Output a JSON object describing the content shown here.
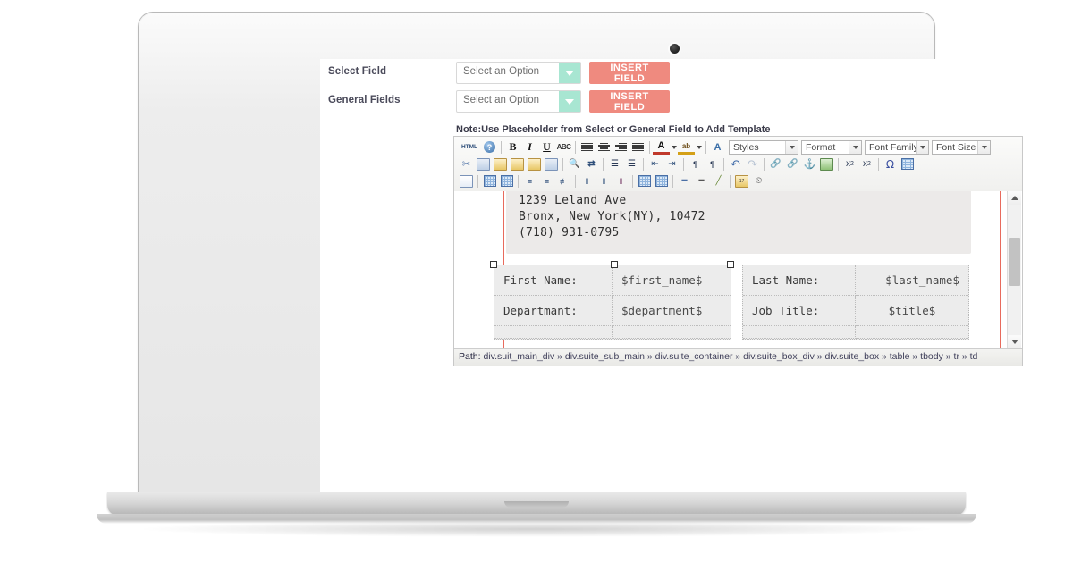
{
  "device": {
    "type": "laptop-mockup",
    "camera": "webcam-dot"
  },
  "form": {
    "rows": [
      {
        "label": "Select Field",
        "select_value": "Select an Option",
        "button": "INSERT FIELD"
      },
      {
        "label": "General Fields",
        "select_value": "Select an Option",
        "button": "INSERT FIELD"
      }
    ],
    "note": "Note:Use Placeholder from Select or General Field to Add Template"
  },
  "editor": {
    "toolbar": {
      "row1": [
        {
          "name": "source-html-icon",
          "glyph": "HTML"
        },
        {
          "name": "help-icon",
          "glyph": "?"
        },
        {
          "name": "bold-icon",
          "glyph": "B"
        },
        {
          "name": "italic-icon",
          "glyph": "I"
        },
        {
          "name": "underline-icon",
          "glyph": "U"
        },
        {
          "name": "strikethrough-icon",
          "glyph": "ABC"
        },
        {
          "name": "align-left-icon",
          "glyph": ""
        },
        {
          "name": "align-center-icon",
          "glyph": ""
        },
        {
          "name": "align-right-icon",
          "glyph": ""
        },
        {
          "name": "align-justify-icon",
          "glyph": ""
        },
        {
          "name": "text-color-icon",
          "glyph": "A"
        },
        {
          "name": "background-color-icon",
          "glyph": "ab"
        },
        {
          "name": "cleanup-icon",
          "glyph": "A"
        }
      ],
      "selects": [
        {
          "name": "styles-select",
          "value": "Styles",
          "width": 78
        },
        {
          "name": "format-select",
          "value": "Format",
          "width": 68
        },
        {
          "name": "font-family-select",
          "value": "Font Family",
          "width": 72
        },
        {
          "name": "font-size-select",
          "value": "Font Size",
          "width": 66
        }
      ],
      "row2": [
        {
          "name": "cut-icon",
          "glyph": "✂"
        },
        {
          "name": "copy-icon",
          "glyph": ""
        },
        {
          "name": "paste-icon",
          "glyph": ""
        },
        {
          "name": "paste-text-icon",
          "glyph": "T"
        },
        {
          "name": "paste-word-icon",
          "glyph": "W"
        },
        {
          "name": "select-all-icon",
          "glyph": "a"
        },
        {
          "name": "find-icon",
          "glyph": "AA"
        },
        {
          "name": "replace-icon",
          "glyph": ""
        },
        {
          "name": "bullet-list-icon",
          "glyph": ""
        },
        {
          "name": "numbered-list-icon",
          "glyph": ""
        },
        {
          "name": "outdent-icon",
          "glyph": ""
        },
        {
          "name": "indent-icon",
          "glyph": ""
        },
        {
          "name": "ltr-icon",
          "glyph": "¶"
        },
        {
          "name": "rtl-icon",
          "glyph": "¶"
        },
        {
          "name": "undo-icon",
          "glyph": "↶"
        },
        {
          "name": "redo-icon",
          "glyph": "↷"
        },
        {
          "name": "link-icon",
          "glyph": "∞"
        },
        {
          "name": "unlink-icon",
          "glyph": "∞"
        },
        {
          "name": "anchor-icon",
          "glyph": "⚓"
        },
        {
          "name": "image-icon",
          "glyph": ""
        },
        {
          "name": "subscript-icon",
          "glyph": "x"
        },
        {
          "name": "superscript-icon",
          "glyph": "x"
        },
        {
          "name": "special-char-icon",
          "glyph": "Ω"
        },
        {
          "name": "insert-table-icon",
          "glyph": ""
        }
      ],
      "row3": [
        {
          "name": "edit-design-icon",
          "glyph": ""
        },
        {
          "name": "table-row-props-icon",
          "glyph": ""
        },
        {
          "name": "table-cell-props-icon",
          "glyph": ""
        },
        {
          "name": "insert-row-before-icon",
          "glyph": ""
        },
        {
          "name": "insert-row-after-icon",
          "glyph": ""
        },
        {
          "name": "delete-row-icon",
          "glyph": ""
        },
        {
          "name": "insert-col-before-icon",
          "glyph": ""
        },
        {
          "name": "insert-col-after-icon",
          "glyph": ""
        },
        {
          "name": "delete-col-icon",
          "glyph": ""
        },
        {
          "name": "split-cell-icon",
          "glyph": ""
        },
        {
          "name": "merge-cell-icon",
          "glyph": ""
        },
        {
          "name": "horizontal-rule-icon",
          "glyph": ""
        },
        {
          "name": "page-break-icon",
          "glyph": ""
        },
        {
          "name": "remove-format-icon",
          "glyph": ""
        },
        {
          "name": "insert-date-icon",
          "glyph": "17"
        },
        {
          "name": "insert-time-icon",
          "glyph": ""
        }
      ]
    },
    "content": {
      "address_lines": [
        "1239 Leland Ave",
        "Bronx, New York(NY), 10472",
        "(718) 931-0795"
      ],
      "table_left": [
        {
          "key": "First Name:",
          "value": "$first_name$"
        },
        {
          "key": "Departmant:",
          "value": "$department$"
        }
      ],
      "table_right": [
        {
          "key": "Last Name:",
          "value": "$last_name$"
        },
        {
          "key": "Job Title:",
          "value": "$title$"
        }
      ]
    },
    "statusbar": {
      "prefix": "Path:",
      "path": " div.suit_main_div » div.suite_sub_main » div.suite_container » div.suite_box_div » div.suite_box » table » tbody » tr » td"
    },
    "scrollbar": {
      "name": "editor-vertical-scrollbar"
    }
  },
  "colors": {
    "accent_salmon": "#ef8a7f",
    "accent_mint": "#a8e6d2",
    "doc_rule_red": "#e86a5c",
    "label_text": "#4a4a5a"
  }
}
